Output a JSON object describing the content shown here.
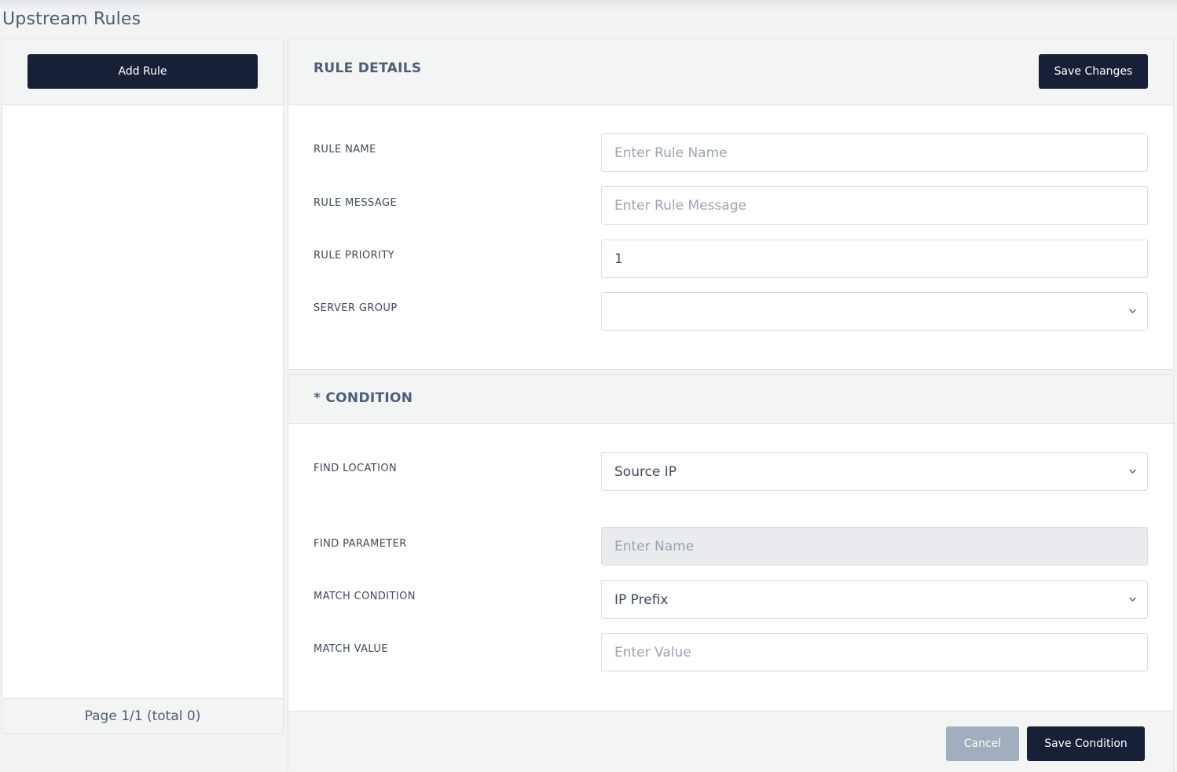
{
  "page": {
    "title": "Upstream Rules"
  },
  "sidebar": {
    "add_rule_label": "Add Rule",
    "pagination": "Page 1/1 (total 0)"
  },
  "rule_details": {
    "title": "RULE DETAILS",
    "save_label": "Save Changes",
    "fields": {
      "rule_name": {
        "label": "RULE NAME",
        "placeholder": "Enter Rule Name",
        "value": ""
      },
      "rule_message": {
        "label": "RULE MESSAGE",
        "placeholder": "Enter Rule Message",
        "value": ""
      },
      "rule_priority": {
        "label": "RULE PRIORITY",
        "value": "1"
      },
      "server_group": {
        "label": "SERVER GROUP",
        "value": ""
      }
    }
  },
  "condition": {
    "title": "* CONDITION",
    "fields": {
      "find_location": {
        "label": "FIND LOCATION",
        "value": "Source IP"
      },
      "find_parameter": {
        "label": "FIND PARAMETER",
        "placeholder": "Enter Name",
        "value": ""
      },
      "match_condition": {
        "label": "MATCH CONDITION",
        "value": "IP Prefix"
      },
      "match_value": {
        "label": "MATCH VALUE",
        "placeholder": "Enter Value",
        "value": ""
      }
    },
    "cancel_label": "Cancel",
    "save_label": "Save Condition"
  },
  "icons": {
    "dropdown": "chevron-down-icon"
  },
  "colors": {
    "primary_button": "#182038",
    "disabled_button": "#a1aebd",
    "text": "#4c5e78"
  }
}
